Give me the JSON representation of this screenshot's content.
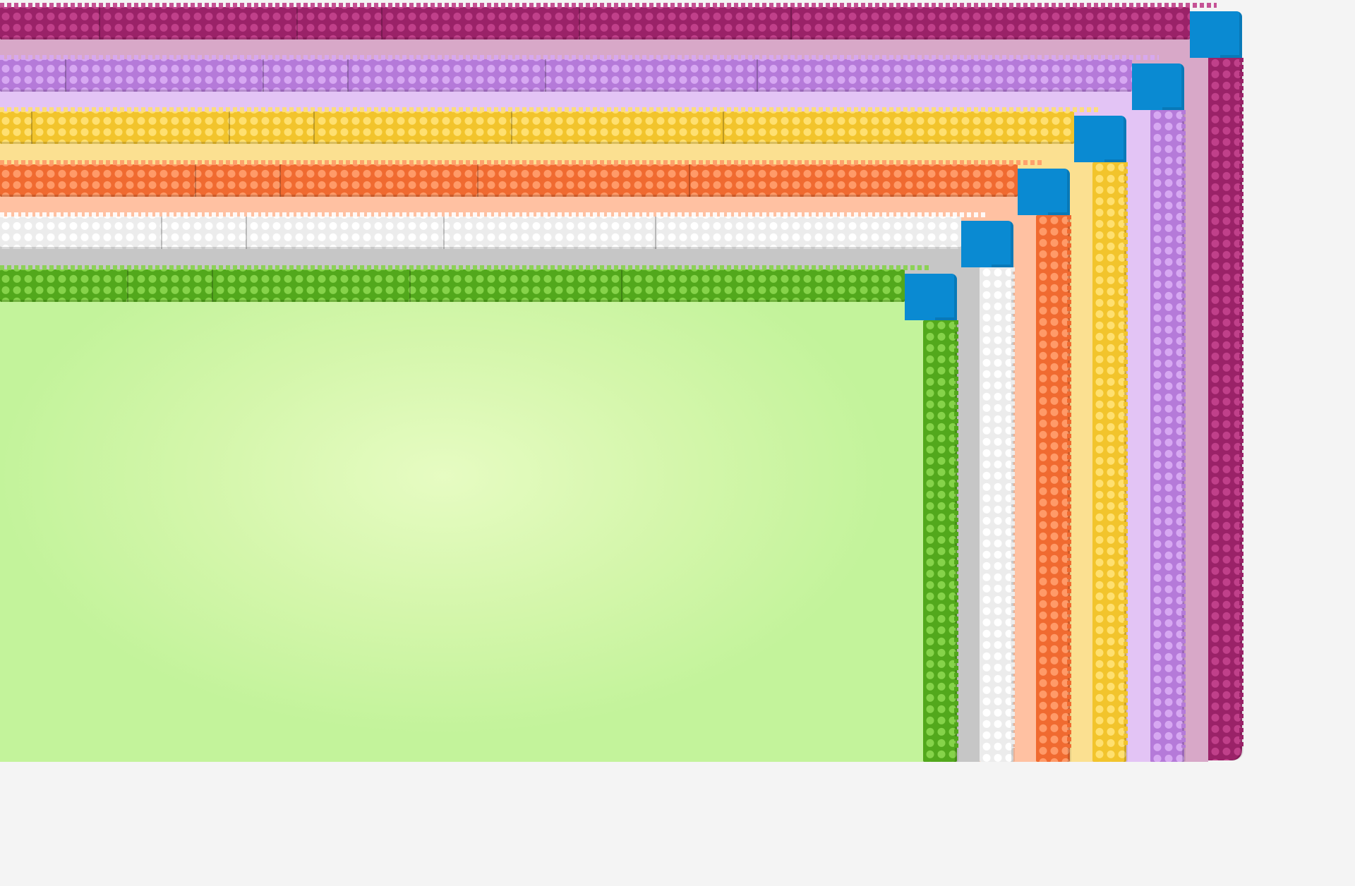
{
  "scene": {
    "description_label": "",
    "frames": [
      {
        "id": "magenta",
        "color": "#9a2268",
        "light": "#c0408a",
        "backing": "#d8a8c8"
      },
      {
        "id": "purple",
        "color": "#b57ad9",
        "light": "#d7a8f2",
        "backing": "#e3c4f5"
      },
      {
        "id": "yellow",
        "color": "#f2c42c",
        "light": "#ffe070",
        "backing": "#fbe091"
      },
      {
        "id": "orange",
        "color": "#f06a30",
        "light": "#ff9a68",
        "backing": "#ffc1a2"
      },
      {
        "id": "white",
        "color": "#ececec",
        "light": "#ffffff",
        "backing": "#c6c6c6"
      },
      {
        "id": "green",
        "color": "#52a81c",
        "light": "#86d34a",
        "backing": "#c3f39b"
      }
    ],
    "corner_color": "#0a8ad2",
    "floor_color": "#f4f4f4"
  }
}
